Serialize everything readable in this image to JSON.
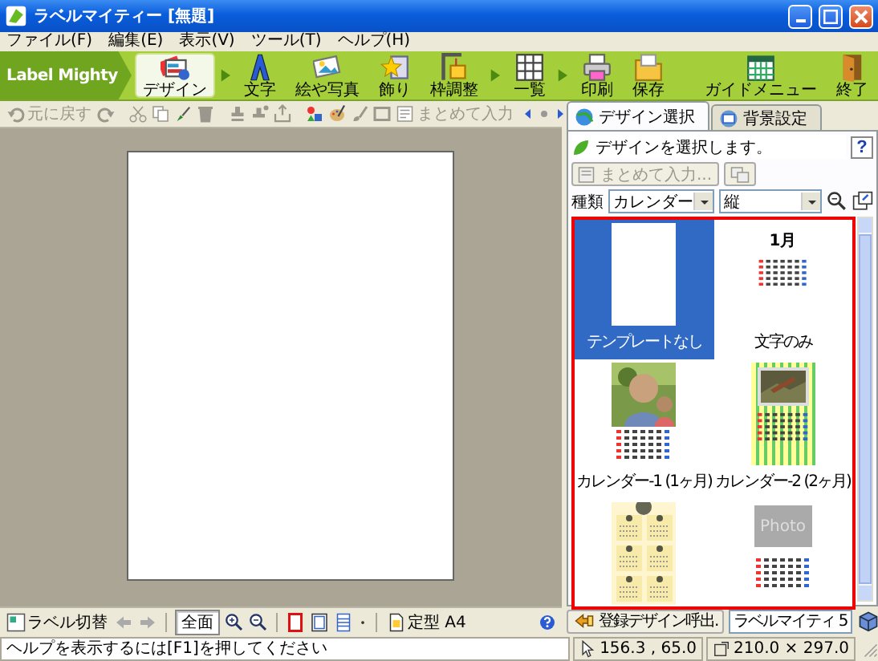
{
  "window": {
    "title": "ラベルマイティー [無題]"
  },
  "menu": [
    {
      "label": "ファイル(F)"
    },
    {
      "label": "編集(E)"
    },
    {
      "label": "表示(V)"
    },
    {
      "label": "ツール(T)"
    },
    {
      "label": "ヘルプ(H)"
    }
  ],
  "logo": "Label Mighty",
  "steps": [
    {
      "kind": "design",
      "label": "デザイン",
      "selected": true,
      "arrow_after": true
    },
    {
      "kind": "text",
      "label": "文字",
      "selected": false,
      "arrow_after": false
    },
    {
      "kind": "picture",
      "label": "絵や写真",
      "selected": false,
      "arrow_after": false
    },
    {
      "kind": "decor",
      "label": "飾り",
      "selected": false,
      "arrow_after": false
    },
    {
      "kind": "frame",
      "label": "枠調整",
      "selected": false,
      "arrow_after": true
    },
    {
      "kind": "list",
      "label": "一覧",
      "selected": false,
      "arrow_after": true
    },
    {
      "kind": "print",
      "label": "印刷",
      "selected": false,
      "arrow_after": false
    },
    {
      "kind": "save",
      "label": "保存",
      "selected": false,
      "arrow_after": false
    }
  ],
  "guide_buttons": [
    {
      "kind": "guide",
      "label": "ガイドメニュー"
    },
    {
      "kind": "exit",
      "label": "終了"
    }
  ],
  "edit_toolbar": {
    "undo": {
      "label": "元に戻す",
      "disabled": true
    },
    "batch_input": {
      "label": "まとめて入力",
      "disabled": true
    }
  },
  "view_toolbar": {
    "label_switch": "ラベル切替",
    "fit": {
      "label": "全面",
      "selected": true
    },
    "paper": "定型 A4"
  },
  "sidebar": {
    "tabs": [
      {
        "label": "デザイン選択",
        "selected": true
      },
      {
        "label": "背景設定",
        "selected": false
      }
    ],
    "message": "デザインを選択します。",
    "help": "?",
    "batch_button": {
      "label": "まとめて入力...",
      "disabled": true
    },
    "type_label": "種類",
    "type_value": "カレンダー",
    "orientation_value": "縦",
    "designs": [
      {
        "kind": "blank",
        "caption": "テンプレートなし",
        "selected": true
      },
      {
        "kind": "text",
        "caption": "文字のみ",
        "selected": false
      },
      {
        "caption": "カレンダー-1 (1ヶ月)",
        "selected": false
      },
      {
        "kind": "framed",
        "caption": "カレンダー-2 (2ヶ月)",
        "selected": false
      },
      {
        "kind": "grid",
        "selected": false
      },
      {
        "kind": "placeholder",
        "selected": false,
        "preview": {
          "text": "Photo"
        }
      }
    ],
    "calendar_preview_month": "1月",
    "recall_button": "登録デザイン呼出.",
    "product_field": "ラベルマイティ 5"
  },
  "status_bar": {
    "hint": "ヘルプを表示するには[F1]を押してください",
    "position": "156.3 , 65.0",
    "size": "210.0 × 297.0"
  }
}
